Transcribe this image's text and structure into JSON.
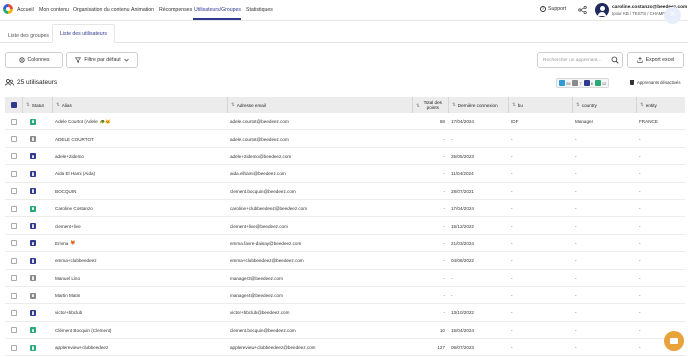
{
  "nav": {
    "items": [
      "Accueil",
      "Mon contenu",
      "Organisation du contenu",
      "Animation",
      "Récompenses",
      "Utilisateurs/Groupes",
      "Statistiques"
    ],
    "active_index": 5,
    "support_label": "Support",
    "user_name": "caroline.costanzo@beedeez.com",
    "user_org": "Ipour KB / TESTS / CHAMP..."
  },
  "tabs": [
    "Liste des groupes",
    "Liste des utilisateurs"
  ],
  "toolbar": {
    "columns_label": "Colonnes",
    "filter_label": "Filtre par défaut",
    "search_placeholder": "Rechercher un apprenant...",
    "export_label": "Export excel"
  },
  "summary": {
    "count_label": "25 utilisateurs",
    "legend": [
      {
        "count": "26",
        "color": "#2f9bd6"
      },
      {
        "count": "7",
        "color": "#8a8a8a"
      },
      {
        "count": "6",
        "color": "#2f3a8f"
      },
      {
        "count": "12",
        "color": "#2aa876"
      }
    ],
    "deactivated_label": "Apprenants désactivés"
  },
  "table": {
    "headers": [
      "Statut",
      "Alias",
      "Adresse email",
      "Total des points",
      "Dernière connexion",
      "bu",
      "country",
      "entity"
    ],
    "rows": [
      {
        "status": "#2aa876",
        "alias": "Adele Courtot (Adele",
        "emoji": "🐢🐱",
        "email": "adele.courtot@beedeez.com",
        "points": "68",
        "last": "17/04/2024",
        "bu": "IDF",
        "country": "Manager",
        "entity": "FRANCE"
      },
      {
        "status": "#8a8a8a",
        "alias": "ADELE COURTOT",
        "emoji": "",
        "email": "adele.courtot@beedeez.com",
        "points": "-",
        "last": "-",
        "bu": "-",
        "country": "-",
        "entity": "-"
      },
      {
        "status": "#2f3a8f",
        "alias": "adele+2idemo",
        "emoji": "",
        "email": "adele+2idemo@beedeez.com",
        "points": "-",
        "last": "25/05/2023",
        "bu": "-",
        "country": "-",
        "entity": "-"
      },
      {
        "status": "#2f3a8f",
        "alias": "Aida El Hami (Aida)",
        "emoji": "",
        "email": "aida.elhami@beedeez.com",
        "points": "-",
        "last": "11/04/2024",
        "bu": "-",
        "country": "-",
        "entity": "-"
      },
      {
        "status": "#2f3a8f",
        "alias": "BOCQUIN",
        "emoji": "",
        "email": "clement.bocquin@beedeez.com",
        "points": "-",
        "last": "28/07/2021",
        "bu": "-",
        "country": "-",
        "entity": "-"
      },
      {
        "status": "#2aa876",
        "alias": "Caroline Costanzo",
        "emoji": "",
        "email": "caroline+clubbeedeez@beedeez.com",
        "points": "-",
        "last": "17/04/2024",
        "bu": "-",
        "country": "-",
        "entity": "-"
      },
      {
        "status": "#2f3a8f",
        "alias": "clement+live",
        "emoji": "",
        "email": "clement+live@beedeez.com",
        "points": "-",
        "last": "15/12/2022",
        "bu": "-",
        "country": "-",
        "entity": "-"
      },
      {
        "status": "#2f3a8f",
        "alias": "Emma",
        "emoji": "🦊",
        "email": "emma.favre-daisay@beedeez.com",
        "points": "-",
        "last": "21/03/2024",
        "bu": "-",
        "country": "-",
        "entity": "-"
      },
      {
        "status": "#2f3a8f",
        "alias": "emma+clubbeedeez",
        "emoji": "",
        "email": "emma+clubbeedeez@beedeez.com",
        "points": "-",
        "last": "04/08/2022",
        "bu": "-",
        "country": "-",
        "entity": "-"
      },
      {
        "status": "#8a8a8a",
        "alias": "Manuel Lino",
        "emoji": "",
        "email": "manager3@beedeez.com",
        "points": "-",
        "last": "-",
        "bu": "-",
        "country": "-",
        "entity": "-"
      },
      {
        "status": "#8a8a8a",
        "alias": "Martin Matin",
        "emoji": "",
        "email": "manager4@beedeez.com",
        "points": "-",
        "last": "-",
        "bu": "-",
        "country": "-",
        "entity": "-"
      },
      {
        "status": "#2f3a8f",
        "alias": "victor+bbclub",
        "emoji": "",
        "email": "victor+bbclub@beedeez.com",
        "points": "-",
        "last": "13/10/2022",
        "bu": "-",
        "country": "-",
        "entity": "-"
      },
      {
        "status": "#2aa876",
        "alias": "Clément Bocquin (Clement)",
        "emoji": "",
        "email": "clement.bocquin@beedeez.com",
        "points": "10",
        "last": "15/04/2024",
        "bu": "-",
        "country": "-",
        "entity": "-"
      },
      {
        "status": "#2aa876",
        "alias": "applereview+clubbeedeez",
        "emoji": "",
        "email": "applereview+clubbeedeez@beedeez.com",
        "points": "127",
        "last": "06/07/2023",
        "bu": "-",
        "country": "-",
        "entity": "-"
      }
    ]
  }
}
